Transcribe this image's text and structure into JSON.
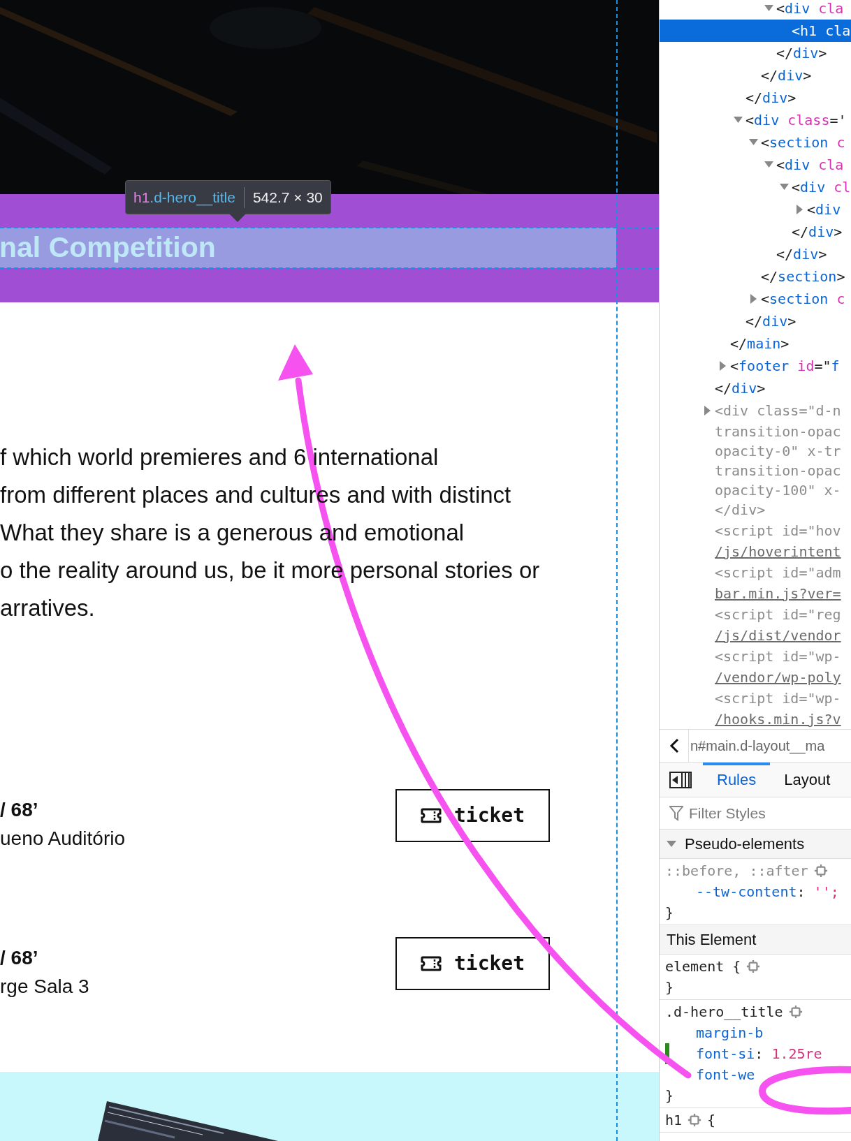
{
  "page": {
    "tooltip": {
      "selector_tag": "h1",
      "selector_class": ".d-hero__title",
      "size": "542.7 × 30"
    },
    "hero_title": "nal Competition",
    "paragraph_lines": [
      "f which world premieres and 6 international",
      "from different places and cultures and with distinct",
      "What they share is a generous and emotional",
      "o the reality around us, be it more personal stories or",
      "arratives."
    ],
    "screenings": [
      {
        "time": "/ 68’",
        "venue": "ueno Auditório",
        "button": "ticket"
      },
      {
        "time": "/ 68’",
        "venue": "rge Sala 3",
        "button": "ticket"
      }
    ]
  },
  "devtools": {
    "markup": [
      {
        "children": [
          {
            "children": [
              {
                "children": [
                  {
                    "children": [
                      {
                        "expanded": true,
                        "selected": false,
                        "lines": [
                          [
                            {
                              "kind": "punct",
                              "text": "<"
                            },
                            {
                              "kind": "tag",
                              "text": "div"
                            },
                            {
                              "kind": "attr",
                              "text": " cla"
                            }
                          ]
                        ],
                        "children": [
                          {
                            "selected": true,
                            "lines": [
                              [
                                {
                                  "kind": "punct",
                                  "text": "<"
                                },
                                {
                                  "kind": "tag",
                                  "text": "h1"
                                },
                                {
                                  "kind": "attr",
                                  "text": " cla"
                                }
                              ]
                            ]
                          }
                        ]
                      },
                      {
                        "selected": false,
                        "lines": [
                          [
                            {
                              "kind": "punct",
                              "text": "</"
                            },
                            {
                              "kind": "tag",
                              "text": "div"
                            },
                            {
                              "kind": "punct",
                              "text": ">"
                            }
                          ]
                        ]
                      }
                    ]
                  },
                  {
                    "selected": false,
                    "lines": [
                      [
                        {
                          "kind": "punct",
                          "text": "</"
                        },
                        {
                          "kind": "tag",
                          "text": "div"
                        },
                        {
                          "kind": "punct",
                          "text": ">"
                        }
                      ]
                    ]
                  }
                ]
              },
              {
                "selected": false,
                "lines": [
                  [
                    {
                      "kind": "punct",
                      "text": "</"
                    },
                    {
                      "kind": "tag",
                      "text": "div"
                    },
                    {
                      "kind": "punct",
                      "text": ">"
                    }
                  ]
                ]
              },
              {
                "expanded": true,
                "selected": false,
                "lines": [
                  [
                    {
                      "kind": "punct",
                      "text": "<"
                    },
                    {
                      "kind": "tag",
                      "text": "div"
                    },
                    {
                      "kind": "attr",
                      "text": " class"
                    },
                    {
                      "kind": "punct",
                      "text": "='"
                    }
                  ]
                ],
                "children": [
                  {
                    "expanded": true,
                    "selected": false,
                    "lines": [
                      [
                        {
                          "kind": "punct",
                          "text": "<"
                        },
                        {
                          "kind": "tag",
                          "text": "section"
                        },
                        {
                          "kind": "attr",
                          "text": " c"
                        }
                      ]
                    ],
                    "children": [
                      {
                        "expanded": true,
                        "selected": false,
                        "lines": [
                          [
                            {
                              "kind": "punct",
                              "text": "<"
                            },
                            {
                              "kind": "tag",
                              "text": "div"
                            },
                            {
                              "kind": "attr",
                              "text": " cla"
                            }
                          ]
                        ],
                        "children": [
                          {
                            "expanded": true,
                            "selected": false,
                            "lines": [
                              [
                                {
                                  "kind": "punct",
                                  "text": "<"
                                },
                                {
                                  "kind": "tag",
                                  "text": "div"
                                },
                                {
                                  "kind": "attr",
                                  "text": " cl"
                                }
                              ]
                            ],
                            "children": [
                              {
                                "expanded": false,
                                "selected": false,
                                "lines": [
                                  [
                                    {
                                      "kind": "punct",
                                      "text": "<"
                                    },
                                    {
                                      "kind": "tag",
                                      "text": "div"
                                    }
                                  ]
                                ]
                              }
                            ]
                          },
                          {
                            "selected": false,
                            "lines": [
                              [
                                {
                                  "kind": "punct",
                                  "text": "</"
                                },
                                {
                                  "kind": "tag",
                                  "text": "div"
                                },
                                {
                                  "kind": "punct",
                                  "text": ">"
                                }
                              ]
                            ]
                          }
                        ]
                      },
                      {
                        "selected": false,
                        "lines": [
                          [
                            {
                              "kind": "punct",
                              "text": "</"
                            },
                            {
                              "kind": "tag",
                              "text": "div"
                            },
                            {
                              "kind": "punct",
                              "text": ">"
                            }
                          ]
                        ]
                      }
                    ]
                  },
                  {
                    "selected": false,
                    "lines": [
                      [
                        {
                          "kind": "punct",
                          "text": "</"
                        },
                        {
                          "kind": "tag",
                          "text": "section"
                        },
                        {
                          "kind": "punct",
                          "text": ">"
                        }
                      ]
                    ]
                  },
                  {
                    "expanded": false,
                    "selected": false,
                    "lines": [
                      [
                        {
                          "kind": "punct",
                          "text": "<"
                        },
                        {
                          "kind": "tag",
                          "text": "section"
                        },
                        {
                          "kind": "attr",
                          "text": " c"
                        }
                      ]
                    ]
                  }
                ]
              },
              {
                "selected": false,
                "lines": [
                  [
                    {
                      "kind": "punct",
                      "text": "</"
                    },
                    {
                      "kind": "tag",
                      "text": "div"
                    },
                    {
                      "kind": "punct",
                      "text": ">"
                    }
                  ]
                ]
              }
            ]
          },
          {
            "selected": false,
            "lines": [
              [
                {
                  "kind": "punct",
                  "text": "</"
                },
                {
                  "kind": "tag",
                  "text": "main"
                },
                {
                  "kind": "punct",
                  "text": ">"
                }
              ]
            ]
          },
          {
            "expanded": false,
            "selected": false,
            "lines": [
              [
                {
                  "kind": "punct",
                  "text": "<"
                },
                {
                  "kind": "tag",
                  "text": "footer"
                },
                {
                  "kind": "attr",
                  "text": " id"
                },
                {
                  "kind": "punct",
                  "text": "=\""
                },
                {
                  "kind": "value",
                  "text": "f"
                }
              ]
            ]
          }
        ]
      },
      {
        "selected": false,
        "lines": [
          [
            {
              "kind": "punct",
              "text": "</"
            },
            {
              "kind": "tag",
              "text": "div"
            },
            {
              "kind": "punct",
              "text": ">"
            }
          ]
        ]
      },
      {
        "expanded": false,
        "selected": false,
        "lines": [
          [
            {
              "kind": "gray",
              "text": "<div class=\"d-n"
            }
          ],
          [
            {
              "kind": "gray",
              "text": "transition-opac"
            }
          ],
          [
            {
              "kind": "gray",
              "text": "opacity-0\" x-tr"
            }
          ],
          [
            {
              "kind": "gray",
              "text": "transition-opac"
            }
          ],
          [
            {
              "kind": "gray",
              "text": "opacity-100\" x-"
            }
          ],
          [
            {
              "kind": "gray",
              "text": "</div>"
            }
          ]
        ]
      },
      {
        "selected": false,
        "lines": [
          [
            {
              "kind": "gray",
              "text": "<script id=\"hov"
            }
          ],
          [
            {
              "kind": "link",
              "text": "/js/hoverintent"
            }
          ]
        ]
      },
      {
        "selected": false,
        "lines": [
          [
            {
              "kind": "gray",
              "text": "<script id=\"adm"
            }
          ],
          [
            {
              "kind": "link",
              "text": "bar.min.js?ver="
            }
          ]
        ]
      },
      {
        "selected": false,
        "lines": [
          [
            {
              "kind": "gray",
              "text": "<script id=\"reg"
            }
          ],
          [
            {
              "kind": "link",
              "text": "/js/dist/vendor"
            }
          ]
        ]
      },
      {
        "selected": false,
        "lines": [
          [
            {
              "kind": "gray",
              "text": "<script id=\"wp-"
            }
          ],
          [
            {
              "kind": "link",
              "text": "/vendor/wp-poly"
            }
          ]
        ]
      },
      {
        "selected": false,
        "lines": [
          [
            {
              "kind": "gray",
              "text": "<script id=\"wp-"
            }
          ],
          [
            {
              "kind": "link",
              "text": "/hooks.min.js?v"
            }
          ]
        ]
      }
    ],
    "breadcrumb": "n#main.d-layout__ma",
    "tabs": [
      {
        "label": "Rules",
        "selected": true
      },
      {
        "label": "Layout",
        "selected": false
      }
    ],
    "filter": {
      "placeholder": "Filter Styles"
    },
    "sections": [
      {
        "kind": "header",
        "title": "Pseudo-elements",
        "expanded": true
      },
      {
        "kind": "rule",
        "selector": "::before, ::after",
        "inactive": true,
        "declarations": [
          {
            "property": "--tw-content",
            "sep": ":",
            "value": "'';",
            "changed": false
          }
        ],
        "close": "}"
      },
      {
        "kind": "header",
        "title": "This Element"
      },
      {
        "kind": "rule",
        "selector": "element {",
        "inactive": false,
        "close": "}"
      },
      {
        "kind": "rule",
        "selector": ".d-hero__title",
        "inactive": false,
        "declarations": [
          {
            "property": "margin-b",
            "changed": false
          },
          {
            "property": "font-si",
            "sep": ":",
            "value": "1.25re",
            "changed": true
          },
          {
            "property": "font-we",
            "changed": false
          }
        ],
        "close": "}"
      },
      {
        "kind": "rule",
        "selector": "h1",
        "inactive": false,
        "open": "{"
      }
    ]
  }
}
